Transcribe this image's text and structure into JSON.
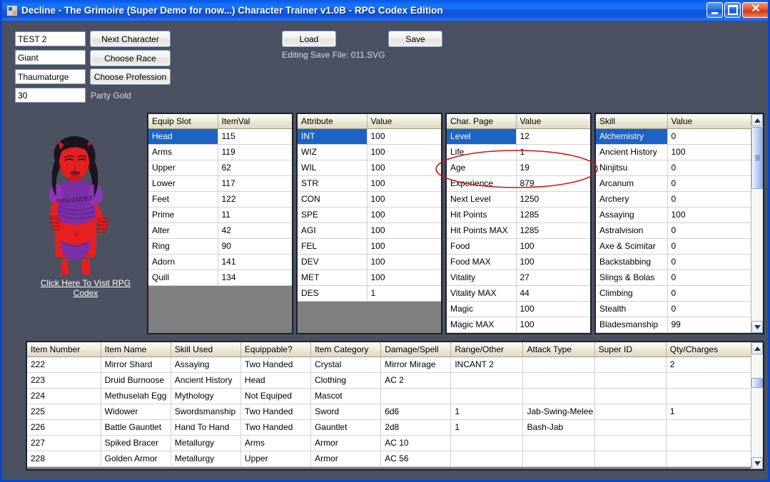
{
  "window": {
    "title": "Decline - The Grimoire (Super Demo for now...) Character Trainer v1.0B - RPG Codex Edition",
    "icon": "app-icon",
    "minimize": "_",
    "maximize": "□",
    "close": "✕",
    "background_color": "#4b5161",
    "titlebar_color": "#1455d8"
  },
  "form": {
    "character_name": "TEST 2",
    "race": "Giant",
    "profession": "Thaumaturge",
    "party_gold": "30",
    "party_gold_label": "Party Gold",
    "next_character_button": "Next Character",
    "choose_race_button": "Choose Race",
    "choose_profession_button": "Choose Profession",
    "load_button": "Load",
    "save_button": "Save",
    "editing_save_file": "Editing Save File: 011.SVG",
    "codex_link": "Click Here To Visit RPG Codex"
  },
  "equip_grid": {
    "headers": [
      "Equip Slot",
      "ItemVal"
    ],
    "rows": [
      [
        "Head",
        "115"
      ],
      [
        "Arms",
        "119"
      ],
      [
        "Upper",
        "62"
      ],
      [
        "Lower",
        "117"
      ],
      [
        "Feet",
        "122"
      ],
      [
        "Prime",
        "11"
      ],
      [
        "Alter",
        "42"
      ],
      [
        "Ring",
        "90"
      ],
      [
        "Adorn",
        "141"
      ],
      [
        "Quill",
        "134"
      ]
    ],
    "selected_row": 0
  },
  "attribute_grid": {
    "headers": [
      "Attribute",
      "Value"
    ],
    "rows": [
      [
        "INT",
        "100"
      ],
      [
        "WIZ",
        "100"
      ],
      [
        "WIL",
        "100"
      ],
      [
        "STR",
        "100"
      ],
      [
        "CON",
        "100"
      ],
      [
        "SPE",
        "100"
      ],
      [
        "AGI",
        "100"
      ],
      [
        "FEL",
        "100"
      ],
      [
        "DEV",
        "100"
      ],
      [
        "MET",
        "100"
      ],
      [
        "DES",
        "1"
      ]
    ],
    "selected_row": 0
  },
  "charpage_grid": {
    "headers": [
      "Char. Page",
      "Value"
    ],
    "rows": [
      [
        "Level",
        "12"
      ],
      [
        "Life",
        "1"
      ],
      [
        "Age",
        "19"
      ],
      [
        "Experience",
        "879"
      ],
      [
        "Next Level",
        "1250"
      ],
      [
        "Hit Points",
        "1285"
      ],
      [
        "Hit Points MAX",
        "1285"
      ],
      [
        "Food",
        "100"
      ],
      [
        "Food MAX",
        "100"
      ],
      [
        "Vitality",
        "27"
      ],
      [
        "Vitality MAX",
        "44"
      ],
      [
        "Magic",
        "100"
      ],
      [
        "Magic MAX",
        "100"
      ]
    ],
    "selected_row": 0,
    "annotation": {
      "shape": "ellipse",
      "color": "#d41414",
      "target_rows": [
        "Age",
        "Experience"
      ]
    }
  },
  "skill_grid": {
    "headers": [
      "Skill",
      "Value"
    ],
    "rows": [
      [
        "Alchemistry",
        "0"
      ],
      [
        "Ancient History",
        "100"
      ],
      [
        "Ninjitsu",
        "0"
      ],
      [
        "Arcanum",
        "0"
      ],
      [
        "Archery",
        "0"
      ],
      [
        "Assaying",
        "100"
      ],
      [
        "Astralvision",
        "0"
      ],
      [
        "Axe & Scimitar",
        "0"
      ],
      [
        "Backstabbing",
        "0"
      ],
      [
        "Slings & Bolas",
        "0"
      ],
      [
        "Climbing",
        "0"
      ],
      [
        "Stealth",
        "0"
      ],
      [
        "Bladesmanship",
        "99"
      ]
    ],
    "selected_row": 0
  },
  "item_table": {
    "headers": [
      "Item Number",
      "Item Name",
      "Skill Used",
      "Equippable?",
      "Item Category",
      "Damage/Spell",
      "Range/Other",
      "Attack Type",
      "Super ID",
      "Qty/Charges"
    ],
    "rows": [
      [
        "222",
        "Mirror Shard",
        "Assaying",
        "Two Handed",
        "Crystal",
        "Mirror Mirage",
        "INCANT 2",
        "",
        "",
        "2"
      ],
      [
        "223",
        "Druid Burnoose",
        "Ancient History",
        "Head",
        "Clothing",
        "AC 2",
        "",
        "",
        "",
        ""
      ],
      [
        "224",
        "Methuselah Egg",
        "Mythology",
        "Not Equiped",
        "Mascot",
        "",
        "",
        "",
        "",
        ""
      ],
      [
        "225",
        "Widower",
        "Swordsmanship",
        "Two Handed",
        "Sword",
        "6d6",
        "1",
        "Jab-Swing-Melee",
        "",
        "1"
      ],
      [
        "226",
        "Battle Gauntlet",
        "Hand To Hand",
        "Two Handed",
        "Gauntlet",
        "2d8",
        "1",
        "Bash-Jab",
        "",
        ""
      ],
      [
        "227",
        "Spiked Bracer",
        "Metallurgy",
        "Arms",
        "Armor",
        "AC 10",
        "",
        "",
        "",
        ""
      ],
      [
        "228",
        "Golden Armor",
        "Metallurgy",
        "Upper",
        "Armor",
        "AC 56",
        "",
        "",
        "",
        ""
      ]
    ]
  },
  "scrollbars": {
    "up_arrow": "▲",
    "down_arrow": "▼"
  }
}
